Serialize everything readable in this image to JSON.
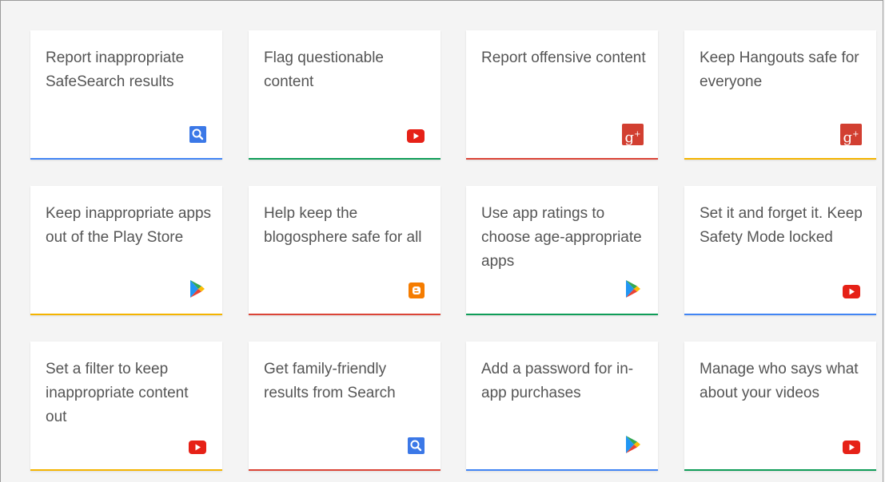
{
  "colors": {
    "blue": "#4285f4",
    "green": "#0f9d58",
    "red": "#db4437",
    "yellow": "#f4b400"
  },
  "cards": [
    {
      "text": "Report inappropriate SafeSearch results",
      "icon": "search-icon",
      "accent": "blue"
    },
    {
      "text": "Flag questionable content",
      "icon": "youtube-icon",
      "accent": "green"
    },
    {
      "text": "Report offensive content",
      "icon": "google-plus-icon",
      "accent": "red"
    },
    {
      "text": "Keep Hangouts safe for everyone",
      "icon": "google-plus-icon",
      "accent": "yellow"
    },
    {
      "text": "Keep inappropriate apps out of the Play Store",
      "icon": "play-store-icon",
      "accent": "yellow"
    },
    {
      "text": "Help keep the blogosphere safe for all",
      "icon": "blogger-icon",
      "accent": "red"
    },
    {
      "text": "Use app ratings to choose age-appropriate apps",
      "icon": "play-store-icon",
      "accent": "green"
    },
    {
      "text": "Set it and forget it. Keep Safety Mode locked",
      "icon": "youtube-icon",
      "accent": "blue"
    },
    {
      "text": "Set a filter to keep inappropriate content out",
      "icon": "youtube-icon",
      "accent": "yellow"
    },
    {
      "text": "Get family-friendly results from Search",
      "icon": "search-icon",
      "accent": "red"
    },
    {
      "text": "Add a password for in-app purchases",
      "icon": "play-store-icon",
      "accent": "blue"
    },
    {
      "text": "Manage who says what about your videos",
      "icon": "youtube-icon",
      "accent": "green"
    }
  ]
}
